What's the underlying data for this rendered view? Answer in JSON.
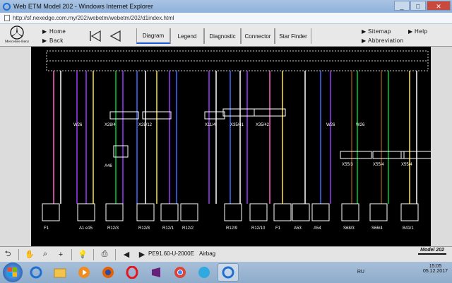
{
  "window": {
    "title": "Web ETM Model 202 - Windows Internet Explorer",
    "url": "http://sf.nexedge.com.my/202/webetm/webetm/202/d1index.html",
    "minimize": "_",
    "maximize": "□",
    "close": "✕"
  },
  "toolbar": {
    "brand": "Mercedes-Benz",
    "home": "Home",
    "back": "Back",
    "tabs": [
      "Diagram",
      "Legend",
      "Diagnostic",
      "Connector",
      "Star Finder"
    ],
    "sitemap": "Sitemap",
    "help": "Help",
    "abbreviation": "Abbreviation"
  },
  "diagram": {
    "top_labels": [
      "W26",
      "X28/4",
      "X28/12",
      "X11/4",
      "X35/41",
      "X35/42",
      "W26",
      "W26",
      "X55/3",
      "X55/4",
      "X55/4"
    ],
    "mid_labels": [
      "A46"
    ],
    "components": [
      "F1",
      "A1 e15",
      "R12/3",
      "R12/8",
      "R12/1",
      "R12/2",
      "R12/9",
      "R12/10",
      "F1",
      "A53",
      "A54",
      "S68/3",
      "S66/4",
      "B41/1"
    ],
    "wire_colors": {
      "pink": "#ff66cc",
      "green": "#00cc33",
      "violet": "#9b3bff",
      "blue": "#3e6bff",
      "yellow": "#ffe640",
      "white": "#ffffff",
      "brown": "#8a4a14",
      "black": "#000000"
    }
  },
  "status": {
    "page_id": "PE91.60-U-2000E",
    "page_title": "Airbag",
    "model": "Model 202"
  },
  "taskbar": {
    "lang": "RU",
    "time": "15:05",
    "date": "05.12.2017"
  }
}
